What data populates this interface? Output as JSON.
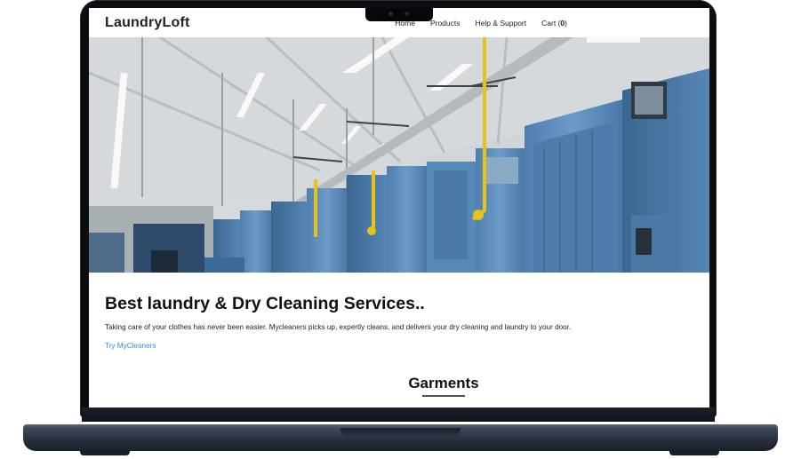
{
  "site": {
    "brand": "LaundryLoft",
    "nav": {
      "home": "Home",
      "products": "Products",
      "help": "Help & Support",
      "cart_label": "Cart",
      "cart_count_open": "(",
      "cart_count": "0",
      "cart_count_close": ")"
    }
  },
  "hero": {
    "image": "industrial-laundry-machines-photo"
  },
  "intro": {
    "headline": "Best laundry & Dry Cleaning Services..",
    "description": "Taking care of your clothes has never been easier. Mycleaners picks up, expertly cleans, and delivers your dry cleaning and laundry to your door.",
    "cta": "Try MyCleaners"
  },
  "section": {
    "title": "Garments"
  },
  "colors": {
    "link": "#3a8ad8",
    "machine_blue": "#5e8fbd",
    "pipe_yellow": "#e8c21a",
    "laptop_body": "#0b0d12"
  }
}
